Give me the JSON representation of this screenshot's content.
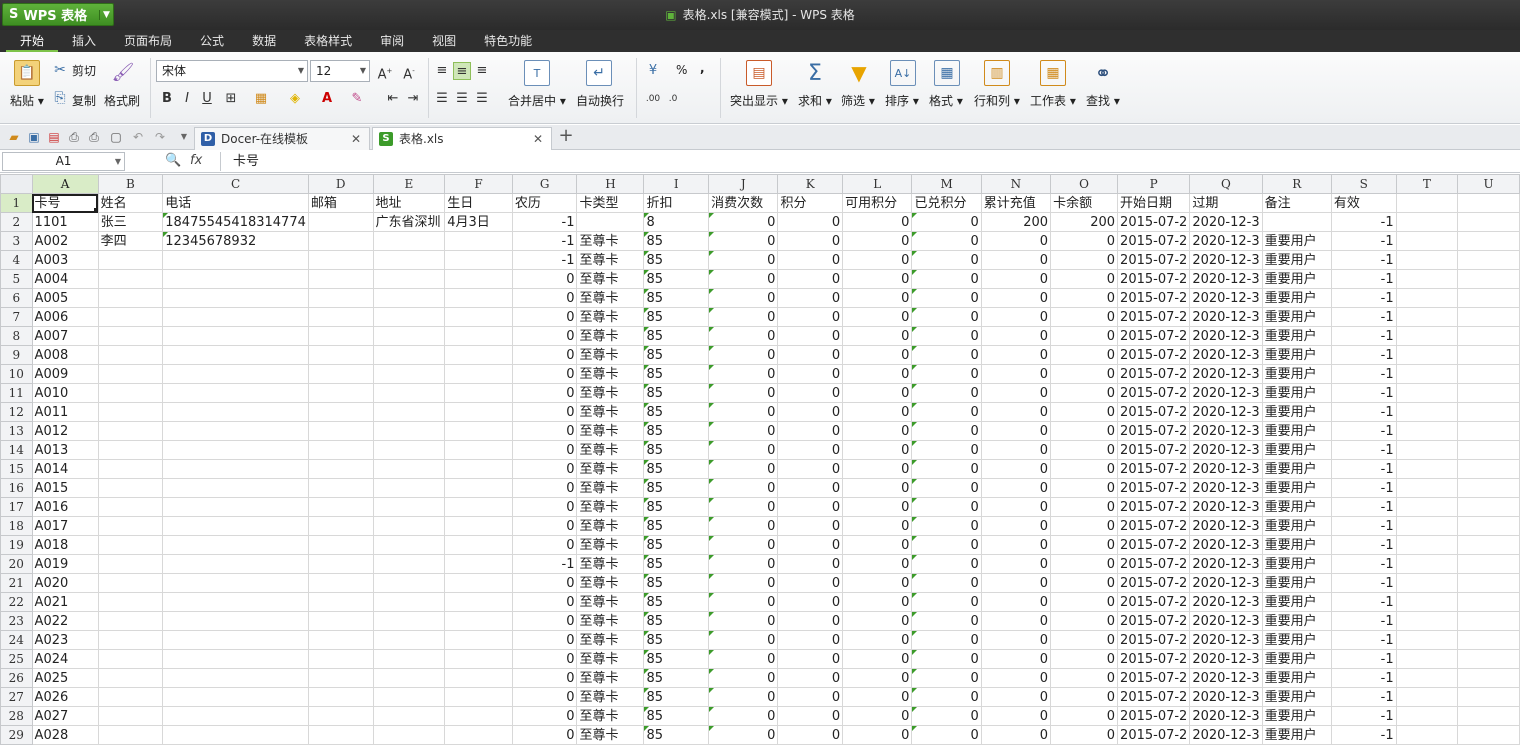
{
  "titlebar": {
    "app_name": "WPS 表格",
    "app_logo": "S",
    "window_title": "表格.xls [兼容模式] - WPS 表格"
  },
  "menu": {
    "tabs": [
      "开始",
      "插入",
      "页面布局",
      "公式",
      "数据",
      "表格样式",
      "审阅",
      "视图",
      "特色功能"
    ],
    "active_index": 0
  },
  "ribbon": {
    "paste": "粘贴",
    "cut": "剪切",
    "copy": "复制",
    "format_painter": "格式刷",
    "font_name": "宋体",
    "font_size": "12",
    "merge_center": "合并居中",
    "wrap_text": "自动换行",
    "percent": "%",
    "comma": ",",
    "highlight": "突出显示",
    "sum": "求和",
    "filter": "筛选",
    "sort": "排序",
    "format": "格式",
    "rows_cols": "行和列",
    "worksheet": "工作表",
    "find": "查找"
  },
  "doc_tabs": [
    {
      "label": "Docer-在线模板",
      "active": false
    },
    {
      "label": "表格.xls",
      "active": true
    }
  ],
  "formula_bar": {
    "name_box": "A1",
    "fx": "fx",
    "content": "卡号"
  },
  "columns": [
    "A",
    "B",
    "C",
    "D",
    "E",
    "F",
    "G",
    "H",
    "I",
    "J",
    "K",
    "L",
    "M",
    "N",
    "O",
    "P",
    "Q",
    "R",
    "S",
    "T",
    "U"
  ],
  "header_row": [
    "卡号",
    "姓名",
    "电话",
    "邮箱",
    "地址",
    "生日",
    "农历",
    "卡类型",
    "折扣",
    "消费次数",
    "积分",
    "可用积分",
    "已兑积分",
    "累计充值",
    "卡余额",
    "开始日期",
    "过期",
    "备注",
    "有效",
    "",
    ""
  ],
  "rows": [
    {
      "n": "2",
      "A": "1101",
      "B": "张三",
      "C": "18475545418314774",
      "D": "",
      "E": "广东省深圳",
      "F": "4月3日",
      "G": "-1",
      "H": "",
      "I": "8",
      "J": "0",
      "K": "0",
      "L": "0",
      "M": "0",
      "N": "200",
      "O": "200",
      "P": "2015-07-2",
      "Q": "2020-12-3",
      "R": "",
      "S": "-1"
    },
    {
      "n": "3",
      "A": "A002",
      "B": "李四",
      "C": "12345678932",
      "D": "",
      "E": "",
      "F": "",
      "G": "-1",
      "H": "至尊卡",
      "I": "85",
      "J": "0",
      "K": "0",
      "L": "0",
      "M": "0",
      "N": "0",
      "O": "0",
      "P": "2015-07-2",
      "Q": "2020-12-3",
      "R": "重要用户",
      "S": "-1"
    },
    {
      "n": "4",
      "A": "A003",
      "G": "-1",
      "H": "至尊卡",
      "I": "85",
      "J": "0",
      "K": "0",
      "L": "0",
      "M": "0",
      "N": "0",
      "O": "0",
      "P": "2015-07-2",
      "Q": "2020-12-3",
      "R": "重要用户",
      "S": "-1"
    },
    {
      "n": "5",
      "A": "A004",
      "G": "0",
      "H": "至尊卡",
      "I": "85",
      "J": "0",
      "K": "0",
      "L": "0",
      "M": "0",
      "N": "0",
      "O": "0",
      "P": "2015-07-2",
      "Q": "2020-12-3",
      "R": "重要用户",
      "S": "-1"
    },
    {
      "n": "6",
      "A": "A005",
      "G": "0",
      "H": "至尊卡",
      "I": "85",
      "J": "0",
      "K": "0",
      "L": "0",
      "M": "0",
      "N": "0",
      "O": "0",
      "P": "2015-07-2",
      "Q": "2020-12-3",
      "R": "重要用户",
      "S": "-1"
    },
    {
      "n": "7",
      "A": "A006",
      "G": "0",
      "H": "至尊卡",
      "I": "85",
      "J": "0",
      "K": "0",
      "L": "0",
      "M": "0",
      "N": "0",
      "O": "0",
      "P": "2015-07-2",
      "Q": "2020-12-3",
      "R": "重要用户",
      "S": "-1"
    },
    {
      "n": "8",
      "A": "A007",
      "G": "0",
      "H": "至尊卡",
      "I": "85",
      "J": "0",
      "K": "0",
      "L": "0",
      "M": "0",
      "N": "0",
      "O": "0",
      "P": "2015-07-2",
      "Q": "2020-12-3",
      "R": "重要用户",
      "S": "-1"
    },
    {
      "n": "9",
      "A": "A008",
      "G": "0",
      "H": "至尊卡",
      "I": "85",
      "J": "0",
      "K": "0",
      "L": "0",
      "M": "0",
      "N": "0",
      "O": "0",
      "P": "2015-07-2",
      "Q": "2020-12-3",
      "R": "重要用户",
      "S": "-1"
    },
    {
      "n": "10",
      "A": "A009",
      "G": "0",
      "H": "至尊卡",
      "I": "85",
      "J": "0",
      "K": "0",
      "L": "0",
      "M": "0",
      "N": "0",
      "O": "0",
      "P": "2015-07-2",
      "Q": "2020-12-3",
      "R": "重要用户",
      "S": "-1"
    },
    {
      "n": "11",
      "A": "A010",
      "G": "0",
      "H": "至尊卡",
      "I": "85",
      "J": "0",
      "K": "0",
      "L": "0",
      "M": "0",
      "N": "0",
      "O": "0",
      "P": "2015-07-2",
      "Q": "2020-12-3",
      "R": "重要用户",
      "S": "-1"
    },
    {
      "n": "12",
      "A": "A011",
      "G": "0",
      "H": "至尊卡",
      "I": "85",
      "J": "0",
      "K": "0",
      "L": "0",
      "M": "0",
      "N": "0",
      "O": "0",
      "P": "2015-07-2",
      "Q": "2020-12-3",
      "R": "重要用户",
      "S": "-1"
    },
    {
      "n": "13",
      "A": "A012",
      "G": "0",
      "H": "至尊卡",
      "I": "85",
      "J": "0",
      "K": "0",
      "L": "0",
      "M": "0",
      "N": "0",
      "O": "0",
      "P": "2015-07-2",
      "Q": "2020-12-3",
      "R": "重要用户",
      "S": "-1"
    },
    {
      "n": "14",
      "A": "A013",
      "G": "0",
      "H": "至尊卡",
      "I": "85",
      "J": "0",
      "K": "0",
      "L": "0",
      "M": "0",
      "N": "0",
      "O": "0",
      "P": "2015-07-2",
      "Q": "2020-12-3",
      "R": "重要用户",
      "S": "-1"
    },
    {
      "n": "15",
      "A": "A014",
      "G": "0",
      "H": "至尊卡",
      "I": "85",
      "J": "0",
      "K": "0",
      "L": "0",
      "M": "0",
      "N": "0",
      "O": "0",
      "P": "2015-07-2",
      "Q": "2020-12-3",
      "R": "重要用户",
      "S": "-1"
    },
    {
      "n": "16",
      "A": "A015",
      "G": "0",
      "H": "至尊卡",
      "I": "85",
      "J": "0",
      "K": "0",
      "L": "0",
      "M": "0",
      "N": "0",
      "O": "0",
      "P": "2015-07-2",
      "Q": "2020-12-3",
      "R": "重要用户",
      "S": "-1"
    },
    {
      "n": "17",
      "A": "A016",
      "G": "0",
      "H": "至尊卡",
      "I": "85",
      "J": "0",
      "K": "0",
      "L": "0",
      "M": "0",
      "N": "0",
      "O": "0",
      "P": "2015-07-2",
      "Q": "2020-12-3",
      "R": "重要用户",
      "S": "-1"
    },
    {
      "n": "18",
      "A": "A017",
      "G": "0",
      "H": "至尊卡",
      "I": "85",
      "J": "0",
      "K": "0",
      "L": "0",
      "M": "0",
      "N": "0",
      "O": "0",
      "P": "2015-07-2",
      "Q": "2020-12-3",
      "R": "重要用户",
      "S": "-1"
    },
    {
      "n": "19",
      "A": "A018",
      "G": "0",
      "H": "至尊卡",
      "I": "85",
      "J": "0",
      "K": "0",
      "L": "0",
      "M": "0",
      "N": "0",
      "O": "0",
      "P": "2015-07-2",
      "Q": "2020-12-3",
      "R": "重要用户",
      "S": "-1"
    },
    {
      "n": "20",
      "A": "A019",
      "G": "-1",
      "H": "至尊卡",
      "I": "85",
      "J": "0",
      "K": "0",
      "L": "0",
      "M": "0",
      "N": "0",
      "O": "0",
      "P": "2015-07-2",
      "Q": "2020-12-3",
      "R": "重要用户",
      "S": "-1"
    },
    {
      "n": "21",
      "A": "A020",
      "G": "0",
      "H": "至尊卡",
      "I": "85",
      "J": "0",
      "K": "0",
      "L": "0",
      "M": "0",
      "N": "0",
      "O": "0",
      "P": "2015-07-2",
      "Q": "2020-12-3",
      "R": "重要用户",
      "S": "-1"
    },
    {
      "n": "22",
      "A": "A021",
      "G": "0",
      "H": "至尊卡",
      "I": "85",
      "J": "0",
      "K": "0",
      "L": "0",
      "M": "0",
      "N": "0",
      "O": "0",
      "P": "2015-07-2",
      "Q": "2020-12-3",
      "R": "重要用户",
      "S": "-1"
    },
    {
      "n": "23",
      "A": "A022",
      "G": "0",
      "H": "至尊卡",
      "I": "85",
      "J": "0",
      "K": "0",
      "L": "0",
      "M": "0",
      "N": "0",
      "O": "0",
      "P": "2015-07-2",
      "Q": "2020-12-3",
      "R": "重要用户",
      "S": "-1"
    },
    {
      "n": "24",
      "A": "A023",
      "G": "0",
      "H": "至尊卡",
      "I": "85",
      "J": "0",
      "K": "0",
      "L": "0",
      "M": "0",
      "N": "0",
      "O": "0",
      "P": "2015-07-2",
      "Q": "2020-12-3",
      "R": "重要用户",
      "S": "-1"
    },
    {
      "n": "25",
      "A": "A024",
      "G": "0",
      "H": "至尊卡",
      "I": "85",
      "J": "0",
      "K": "0",
      "L": "0",
      "M": "0",
      "N": "0",
      "O": "0",
      "P": "2015-07-2",
      "Q": "2020-12-3",
      "R": "重要用户",
      "S": "-1"
    },
    {
      "n": "26",
      "A": "A025",
      "G": "0",
      "H": "至尊卡",
      "I": "85",
      "J": "0",
      "K": "0",
      "L": "0",
      "M": "0",
      "N": "0",
      "O": "0",
      "P": "2015-07-2",
      "Q": "2020-12-3",
      "R": "重要用户",
      "S": "-1"
    },
    {
      "n": "27",
      "A": "A026",
      "G": "0",
      "H": "至尊卡",
      "I": "85",
      "J": "0",
      "K": "0",
      "L": "0",
      "M": "0",
      "N": "0",
      "O": "0",
      "P": "2015-07-2",
      "Q": "2020-12-3",
      "R": "重要用户",
      "S": "-1"
    },
    {
      "n": "28",
      "A": "A027",
      "G": "0",
      "H": "至尊卡",
      "I": "85",
      "J": "0",
      "K": "0",
      "L": "0",
      "M": "0",
      "N": "0",
      "O": "0",
      "P": "2015-07-2",
      "Q": "2020-12-3",
      "R": "重要用户",
      "S": "-1"
    },
    {
      "n": "29",
      "A": "A028",
      "G": "0",
      "H": "至尊卡",
      "I": "85",
      "J": "0",
      "K": "0",
      "L": "0",
      "M": "0",
      "N": "0",
      "O": "0",
      "P": "2015-07-2",
      "Q": "2020-12-3",
      "R": "重要用户",
      "S": "-1"
    }
  ],
  "colors": {
    "accent_green": "#5fb23b",
    "selection_header": "#d9ecc7",
    "text_marker": "#3c9b2a"
  }
}
